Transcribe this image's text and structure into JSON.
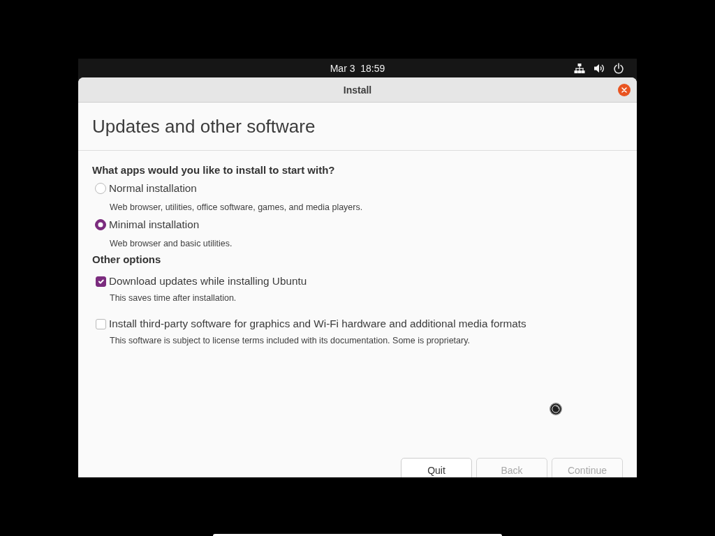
{
  "top_bar": {
    "clock": "Mar 3  18:59"
  },
  "window": {
    "title": "Install"
  },
  "page": {
    "heading": "Updates and other software"
  },
  "install_type": {
    "question": "What apps would you like to install to start with?",
    "options": [
      {
        "label": "Normal installation",
        "description": "Web browser, utilities, office software, games, and media players.",
        "selected": false
      },
      {
        "label": "Minimal installation",
        "description": "Web browser and basic utilities.",
        "selected": true
      }
    ]
  },
  "other_options": {
    "heading": "Other options",
    "options": [
      {
        "label": "Download updates while installing Ubuntu",
        "description": "This saves time after installation.",
        "checked": true
      },
      {
        "label": "Install third-party software for graphics and Wi-Fi hardware and additional media formats",
        "description": "This software is subject to license terms included with its documentation. Some is proprietary.",
        "checked": false
      }
    ]
  },
  "buttons": [
    {
      "label": "Quit",
      "disabled": false
    },
    {
      "label": "Back",
      "disabled": true
    },
    {
      "label": "Continue",
      "disabled": true
    }
  ]
}
